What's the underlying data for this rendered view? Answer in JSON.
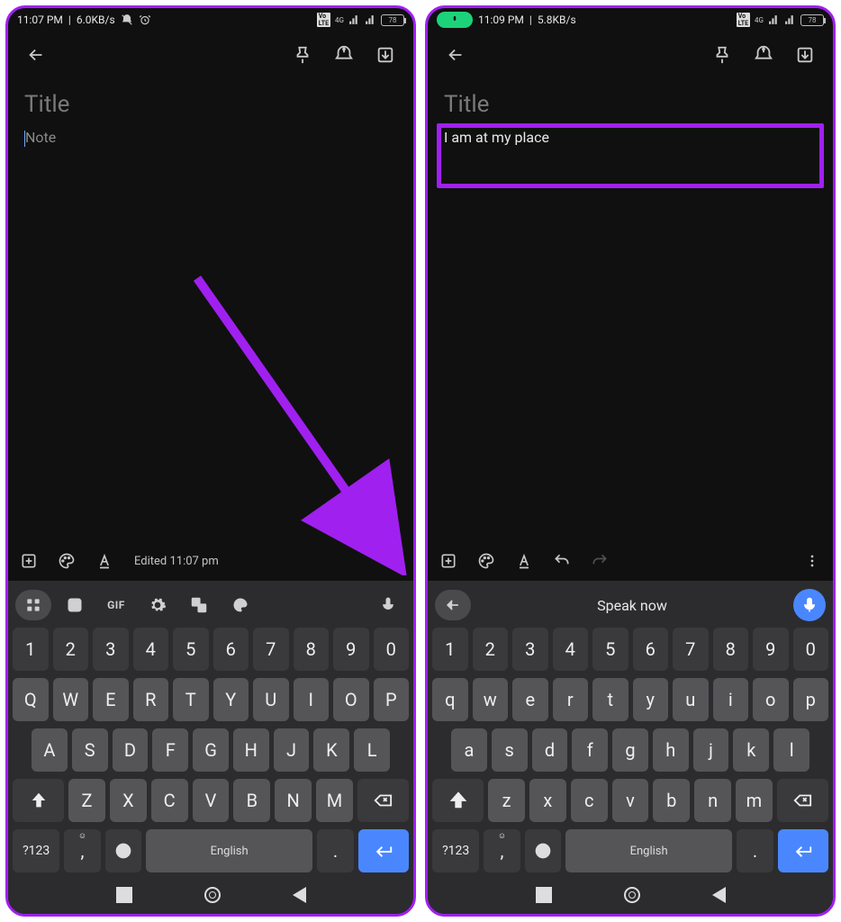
{
  "left": {
    "status": {
      "time": "11:07 PM",
      "speed": "6.0KB/s",
      "battery": "78"
    },
    "title_placeholder": "Title",
    "body_placeholder": "Note",
    "edited": "Edited 11:07 pm",
    "kb": {
      "toolbar": {
        "gif": "GIF"
      },
      "row_num": [
        "1",
        "2",
        "3",
        "4",
        "5",
        "6",
        "7",
        "8",
        "9",
        "0"
      ],
      "row1": [
        "Q",
        "W",
        "E",
        "R",
        "T",
        "Y",
        "U",
        "I",
        "O",
        "P"
      ],
      "row2": [
        "A",
        "S",
        "D",
        "F",
        "G",
        "H",
        "J",
        "K",
        "L"
      ],
      "row3": [
        "Z",
        "X",
        "C",
        "V",
        "B",
        "N",
        "M"
      ],
      "sym": "?123",
      "comma": ",",
      "space": "English",
      "period": "."
    }
  },
  "right": {
    "status": {
      "time": "11:09 PM",
      "speed": "5.8KB/s",
      "battery": "78"
    },
    "title_placeholder": "Title",
    "body_text": "I am at my place",
    "kb": {
      "toolbar": {
        "speak": "Speak now"
      },
      "row_num": [
        "1",
        "2",
        "3",
        "4",
        "5",
        "6",
        "7",
        "8",
        "9",
        "0"
      ],
      "row1": [
        "q",
        "w",
        "e",
        "r",
        "t",
        "y",
        "u",
        "i",
        "o",
        "p"
      ],
      "row2": [
        "a",
        "s",
        "d",
        "f",
        "g",
        "h",
        "j",
        "k",
        "l"
      ],
      "row3": [
        "z",
        "x",
        "c",
        "v",
        "b",
        "n",
        "m"
      ],
      "sym": "?123",
      "comma": ",",
      "space": "English",
      "period": "."
    }
  }
}
